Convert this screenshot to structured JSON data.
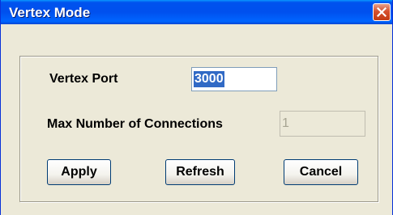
{
  "window": {
    "title": "Vertex Mode",
    "close_icon": "close-icon"
  },
  "form": {
    "vertex_port_label": "Vertex Port",
    "vertex_port_value": "3000",
    "max_connections_label": "Max Number of Connections",
    "max_connections_value": "1"
  },
  "buttons": {
    "apply": "Apply",
    "refresh": "Refresh",
    "cancel": "Cancel"
  },
  "colors": {
    "titlebar": "#0054e3",
    "dialog_background": "#ece9d8",
    "selection": "#316ac5",
    "close_button": "#d6512f"
  }
}
